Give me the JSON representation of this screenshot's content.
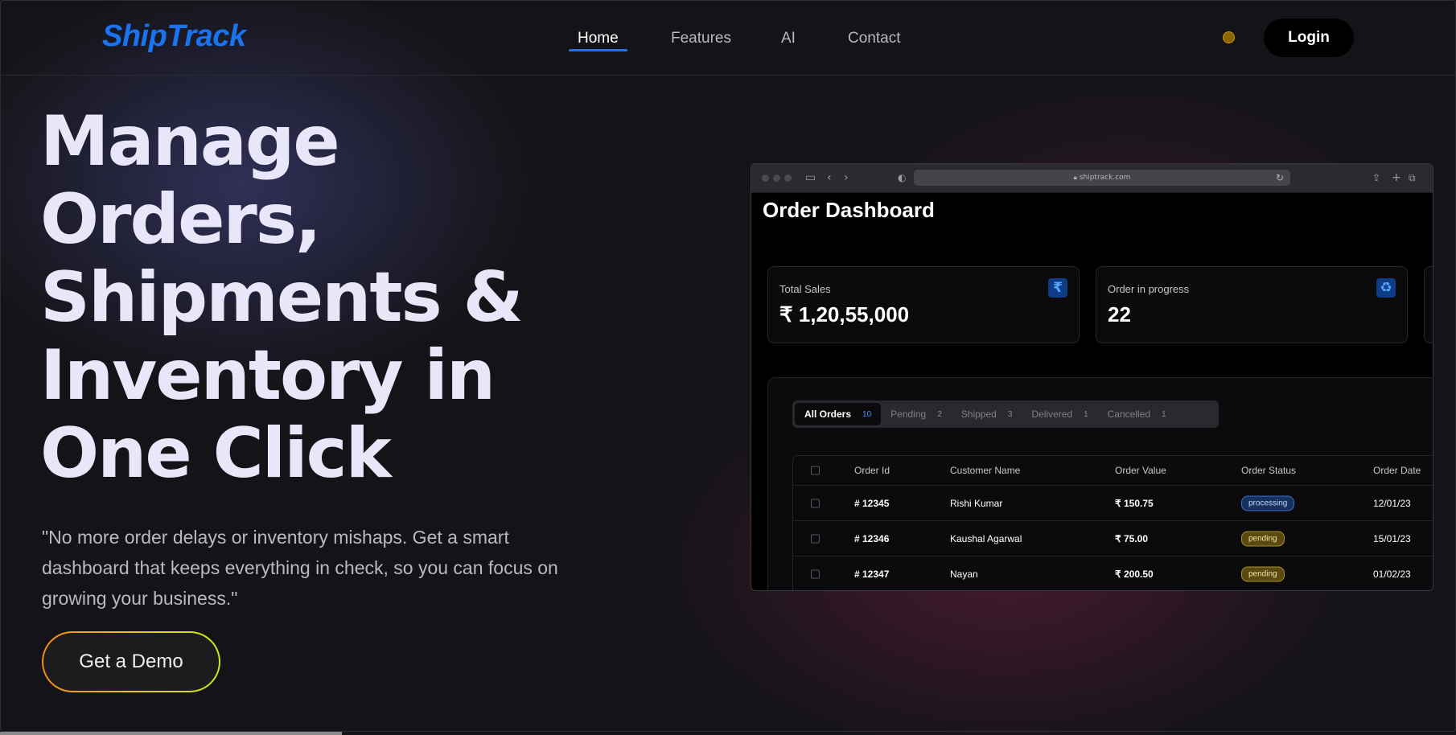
{
  "brand": {
    "logo": "ShipTrack",
    "accent_color": "#1a73f0"
  },
  "nav": {
    "links": [
      {
        "label": "Home",
        "active": true
      },
      {
        "label": "Features",
        "active": false
      },
      {
        "label": "AI",
        "active": false
      },
      {
        "label": "Contact",
        "active": false
      }
    ],
    "theme_toggle_icon": "sun-icon",
    "login_label": "Login"
  },
  "hero": {
    "title_lines": [
      "Manage",
      "Orders,",
      "Shipments &",
      "Inventory in",
      "One Click"
    ],
    "quote": "\"No more order delays or inventory mishaps. Get a smart dashboard that keeps everything in check, so you can focus on growing your business.\"",
    "cta_label": "Get a Demo"
  },
  "mockup": {
    "url": "shiptrack.com",
    "dashboard_title": "Order Dashboard",
    "stats": [
      {
        "label": "Total Sales",
        "value": "₹ 1,20,55,000",
        "icon": "rupee-icon"
      },
      {
        "label": "Order in progress",
        "value": "22",
        "icon": "recycle-icon"
      }
    ],
    "tabs": [
      {
        "label": "All Orders",
        "count": "10",
        "active": true
      },
      {
        "label": "Pending",
        "count": "2",
        "active": false
      },
      {
        "label": "Shipped",
        "count": "3",
        "active": false
      },
      {
        "label": "Delivered",
        "count": "1",
        "active": false
      },
      {
        "label": "Cancelled",
        "count": "1",
        "active": false
      }
    ],
    "table": {
      "columns": [
        "Order Id",
        "Customer Name",
        "Order Value",
        "Order Status",
        "Order Date"
      ],
      "rows": [
        {
          "id": "# 12345",
          "customer": "Rishi Kumar",
          "value": "₹ 150.75",
          "status": "processing",
          "date": "12/01/23"
        },
        {
          "id": "# 12346",
          "customer": "Kaushal Agarwal",
          "value": "₹ 75.00",
          "status": "pending",
          "date": "15/01/23"
        },
        {
          "id": "# 12347",
          "customer": "Nayan",
          "value": "₹ 200.50",
          "status": "pending",
          "date": "01/02/23"
        }
      ]
    }
  }
}
